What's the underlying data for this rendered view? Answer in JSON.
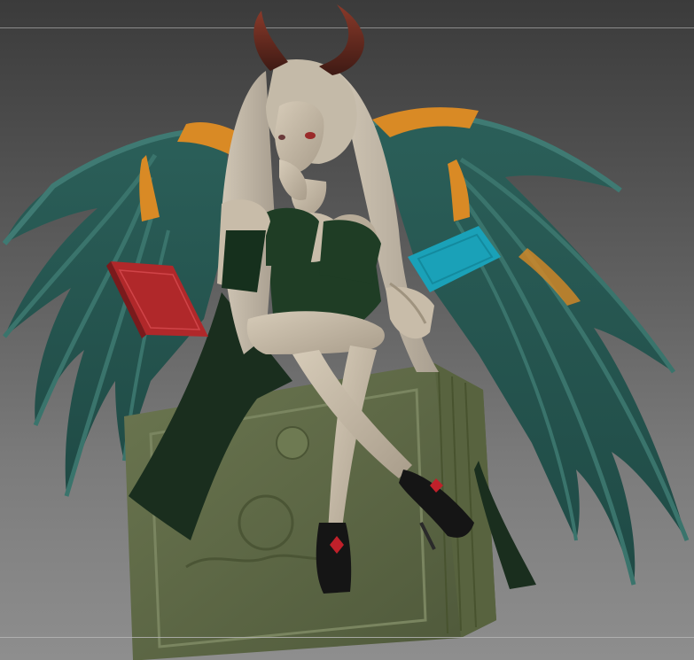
{
  "viewport": {
    "background_top": "#3b3b3b",
    "background_bottom": "#8e8e8e",
    "guide_line_color": "#9a9a9a"
  },
  "model": {
    "colors": {
      "wing_membrane": "#2f6660",
      "wing_bone": "#3f7a73",
      "wing_tip": "#d98a25",
      "horn": "#7a2a20",
      "skin": "#c8bca9",
      "hair": "#bfb6a6",
      "dress": "#1f3d25",
      "pedestal": "#5f6b45",
      "red_book": "#b0282a",
      "cyan_card": "#1aa1b8",
      "shoe": "#151515"
    }
  }
}
